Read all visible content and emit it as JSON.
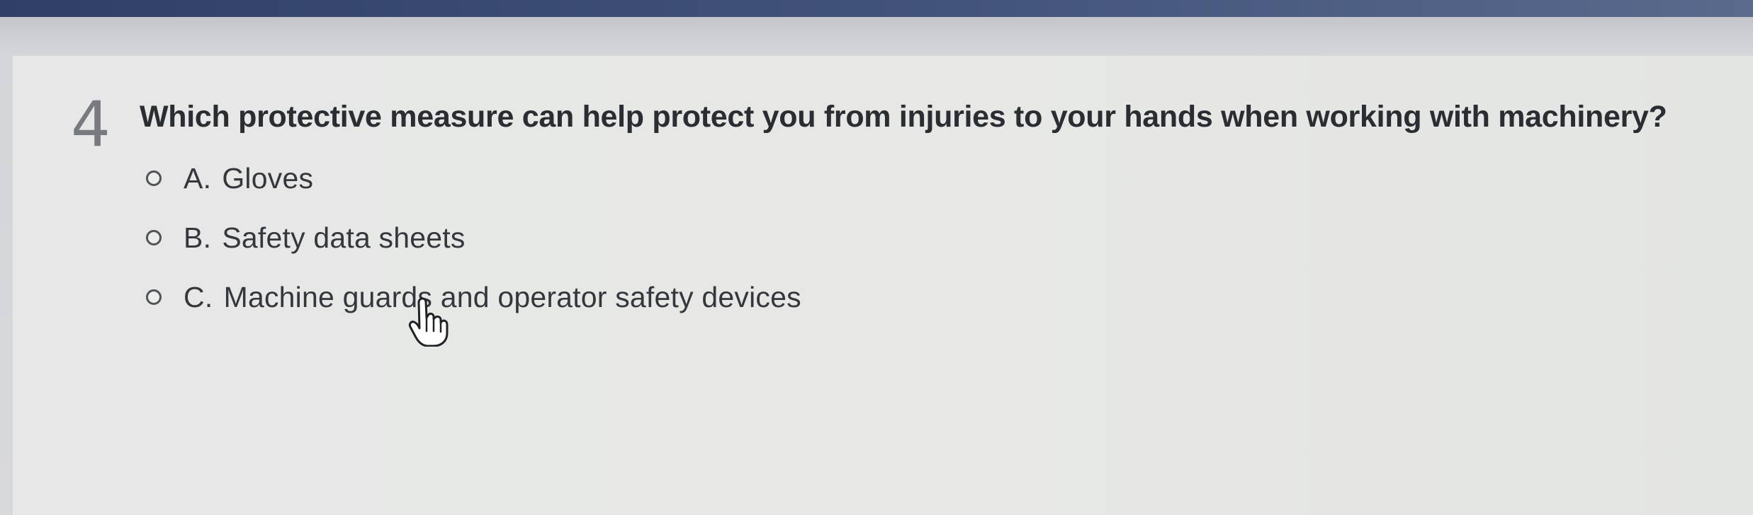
{
  "question": {
    "number": "4",
    "text": "Which protective measure can help protect you from injuries to your hands when working with machinery?",
    "options": [
      {
        "letter": "A.",
        "text": "Gloves"
      },
      {
        "letter": "B.",
        "text": "Safety data sheets"
      },
      {
        "letter": "C.",
        "text": "Machine guards and operator safety devices"
      }
    ]
  },
  "icons": {
    "radio": "radio-button-icon",
    "cursor": "hand-pointer-icon"
  },
  "colors": {
    "top_bar": "#2f3f66",
    "panel_background": "#e6e7e6",
    "question_text": "#2a2d31",
    "option_text": "#34373b",
    "question_number": "#777b80"
  }
}
